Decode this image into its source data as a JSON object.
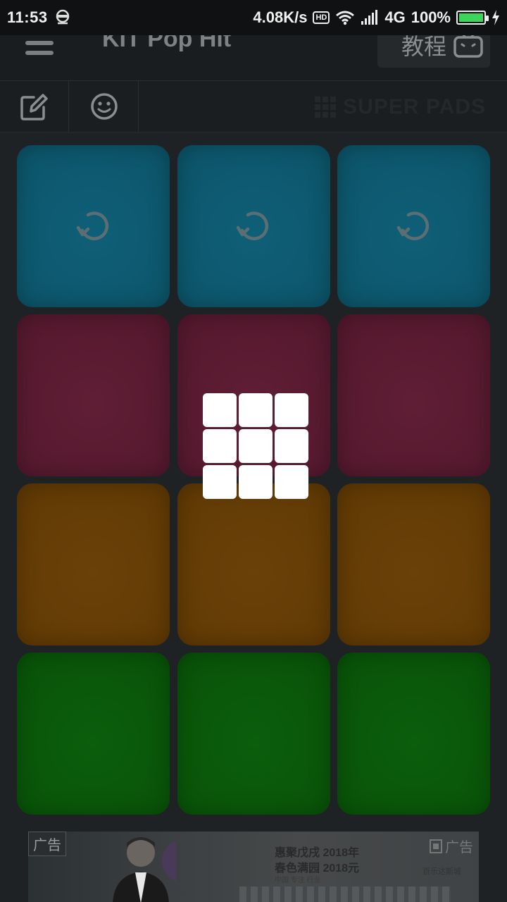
{
  "status_bar": {
    "time": "11:53",
    "speed": "4.08K/s",
    "hd": "HD",
    "network": "4G",
    "battery": "100%",
    "battery_level": 1.0
  },
  "header": {
    "title": "KIT Pop Hit",
    "tutorial_label": "教程"
  },
  "toolbar": {
    "super_pads_label": "SUPER PADS"
  },
  "pads": {
    "rows": [
      {
        "color": "blue",
        "items": [
          {
            "icon": "loop-icon"
          },
          {
            "icon": "loop-icon"
          },
          {
            "icon": "loop-icon"
          }
        ]
      },
      {
        "color": "red",
        "items": [
          {},
          {},
          {}
        ]
      },
      {
        "color": "orange",
        "items": [
          {},
          {},
          {}
        ]
      },
      {
        "color": "green",
        "items": [
          {},
          {},
          {}
        ]
      }
    ]
  },
  "ad": {
    "tag": "广告",
    "tag_right": "广告",
    "line1": "惠聚戊戌 2018年",
    "line2": "春色满园 2018元",
    "line3": "中国 专注 行业",
    "brand": "百乐达斯城"
  },
  "colors": {
    "pad_blue": "#0c5468",
    "pad_red": "#54182d",
    "pad_orange": "#603904",
    "pad_green": "#095208",
    "background": "#1e2224"
  }
}
